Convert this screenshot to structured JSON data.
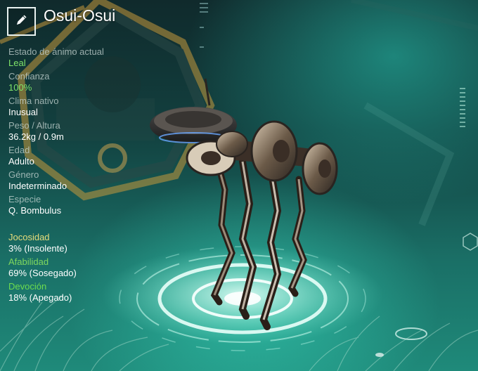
{
  "creature": {
    "name": "Osui-Osui"
  },
  "stats": [
    {
      "label": "Estado de ánimo actual",
      "value": "Leal",
      "highlight": true
    },
    {
      "label": "Confianza",
      "value": "100%",
      "highlight": true
    },
    {
      "label": "Clima nativo",
      "value": "Inusual",
      "highlight": false
    },
    {
      "label": "Peso / Altura",
      "value": "36.2kg / 0.9m",
      "highlight": false
    },
    {
      "label": "Edad",
      "value": "Adulto",
      "highlight": false
    },
    {
      "label": "Género",
      "value": "Indeterminado",
      "highlight": false
    },
    {
      "label": "Especie",
      "value": "Q. Bombulus",
      "highlight": false
    }
  ],
  "traits": [
    {
      "label": "Jocosidad",
      "value": "3% (Insolente)"
    },
    {
      "label": "Afabilidad",
      "value": "69% (Sosegado)"
    },
    {
      "label": "Devoción",
      "value": "18% (Apegado)"
    }
  ],
  "icons": {
    "edit": "pencil-icon",
    "side_menu": "hexagon-icon"
  },
  "colors": {
    "highlight_green": "#7fe36a",
    "humor": "#e6dc7a",
    "kindness": "#7fd85e",
    "devotion": "#6ddc4e"
  }
}
